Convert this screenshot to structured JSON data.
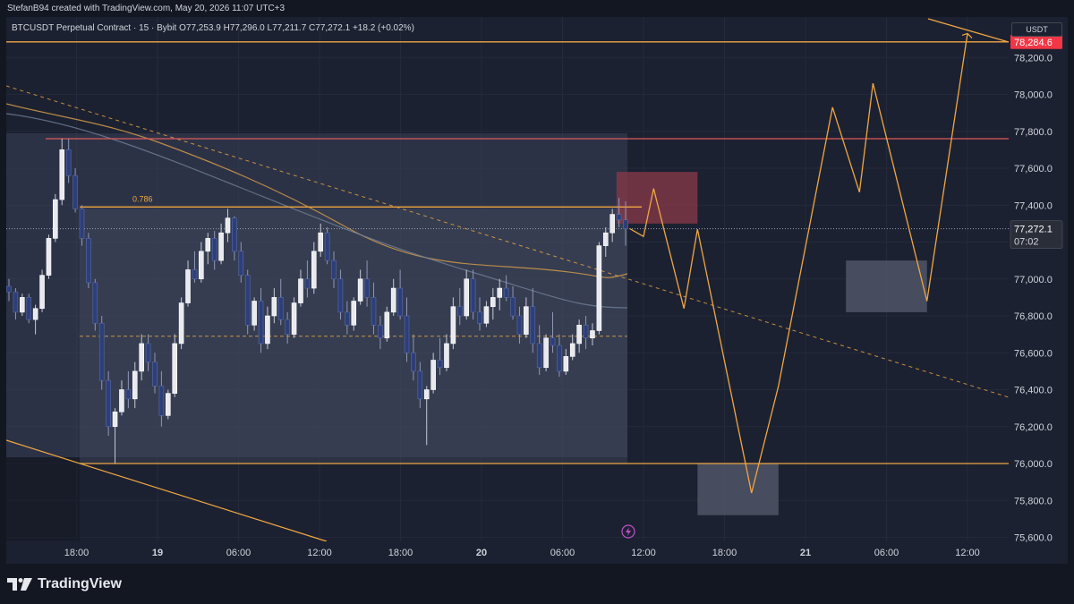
{
  "caption": "StefanB94 created with TradingView.com, May 20, 2026 11:07 UTC+3",
  "symbol": {
    "name": "BTCUSDT Perpetual Contract · 15 · Bybit",
    "ohlc": "O77,253.9  H77,296.0  L77,211.7  C77,272.1  +18.2 (+0.02%)"
  },
  "currency": "USDT",
  "watermark": "TradingView",
  "fib_label": "0.786",
  "colors": {
    "background": "#1c2131",
    "bull": "#e8eaef",
    "bear": "#2d3f7a",
    "accent": "#f0a742",
    "resistance": "#e05a5a",
    "price_tag": "#f23645"
  },
  "chart_data": {
    "type": "candlestick",
    "ylim": [
      75600,
      78400
    ],
    "price_ticks": [
      "75,600.0",
      "75,800.0",
      "76,000.0",
      "76,200.0",
      "76,400.0",
      "76,600.0",
      "76,800.0",
      "77,000.0",
      "77,200.0",
      "77,400.0",
      "77,600.0",
      "77,800.0",
      "78,000.0",
      "78,200.0"
    ],
    "time_ticks": [
      {
        "label": "18:00",
        "bold": false
      },
      {
        "label": "19",
        "bold": true
      },
      {
        "label": "06:00",
        "bold": false
      },
      {
        "label": "12:00",
        "bold": false
      },
      {
        "label": "18:00",
        "bold": false
      },
      {
        "label": "20",
        "bold": true
      },
      {
        "label": "06:00",
        "bold": false
      },
      {
        "label": "12:00",
        "bold": false
      },
      {
        "label": "18:00",
        "bold": false
      },
      {
        "label": "21",
        "bold": true
      },
      {
        "label": "06:00",
        "bold": false
      },
      {
        "label": "12:00",
        "bold": false
      }
    ],
    "last_price": {
      "value": 77272.1,
      "label": "77,272.1",
      "countdown": "07:02"
    },
    "target_price": {
      "value": 78284.6,
      "label": "78,284.6"
    },
    "levels": {
      "top": 78284.6,
      "resistance": 77760,
      "fib": 77390,
      "mid": 76690,
      "support": 76000
    },
    "candles": [
      [
        76960,
        77000,
        76880,
        76930
      ],
      [
        76930,
        76950,
        76780,
        76820
      ],
      [
        76820,
        76920,
        76800,
        76900
      ],
      [
        76900,
        76920,
        76760,
        76780
      ],
      [
        76780,
        76860,
        76700,
        76840
      ],
      [
        76840,
        77050,
        76820,
        77020
      ],
      [
        77020,
        77240,
        77000,
        77220
      ],
      [
        77220,
        77460,
        77200,
        77430
      ],
      [
        77430,
        77760,
        77400,
        77700
      ],
      [
        77700,
        77760,
        77520,
        77560
      ],
      [
        77560,
        77600,
        77360,
        77380
      ],
      [
        77380,
        77400,
        77180,
        77220
      ],
      [
        77220,
        77250,
        76950,
        76980
      ],
      [
        76980,
        77000,
        76720,
        76760
      ],
      [
        76760,
        76800,
        76400,
        76450
      ],
      [
        76450,
        76500,
        76150,
        76200
      ],
      [
        76200,
        76300,
        76000,
        76280
      ],
      [
        76280,
        76450,
        76260,
        76400
      ],
      [
        76400,
        76500,
        76300,
        76350
      ],
      [
        76350,
        76550,
        76300,
        76500
      ],
      [
        76500,
        76700,
        76450,
        76650
      ],
      [
        76650,
        76700,
        76500,
        76550
      ],
      [
        76550,
        76600,
        76380,
        76420
      ],
      [
        76420,
        76500,
        76200,
        76260
      ],
      [
        76260,
        76400,
        76240,
        76380
      ],
      [
        76380,
        76700,
        76360,
        76650
      ],
      [
        76650,
        76900,
        76620,
        76870
      ],
      [
        76870,
        77100,
        76850,
        77050
      ],
      [
        77050,
        77150,
        76980,
        77000
      ],
      [
        77000,
        77200,
        76980,
        77150
      ],
      [
        77150,
        77250,
        77080,
        77220
      ],
      [
        77220,
        77260,
        77050,
        77100
      ],
      [
        77100,
        77300,
        77080,
        77250
      ],
      [
        77250,
        77380,
        77200,
        77330
      ],
      [
        77330,
        77340,
        77100,
        77150
      ],
      [
        77150,
        77200,
        76980,
        77020
      ],
      [
        77020,
        77050,
        76700,
        76750
      ],
      [
        76750,
        76900,
        76720,
        76880
      ],
      [
        76880,
        76950,
        76600,
        76650
      ],
      [
        76650,
        76850,
        76620,
        76800
      ],
      [
        76800,
        76950,
        76760,
        76900
      ],
      [
        76900,
        77000,
        76750,
        76780
      ],
      [
        76780,
        76820,
        76650,
        76700
      ],
      [
        76700,
        76900,
        76680,
        76870
      ],
      [
        76870,
        77050,
        76850,
        77000
      ],
      [
        77000,
        77100,
        76900,
        76950
      ],
      [
        76950,
        77200,
        76920,
        77150
      ],
      [
        77150,
        77300,
        77120,
        77250
      ],
      [
        77250,
        77280,
        77080,
        77100
      ],
      [
        77100,
        77150,
        76950,
        77000
      ],
      [
        77000,
        77050,
        76780,
        76820
      ],
      [
        76820,
        76880,
        76700,
        76750
      ],
      [
        76750,
        76900,
        76720,
        76880
      ],
      [
        76880,
        77050,
        76860,
        77000
      ],
      [
        77000,
        77100,
        76850,
        76900
      ],
      [
        76900,
        76980,
        76700,
        76750
      ],
      [
        76750,
        76800,
        76620,
        76680
      ],
      [
        76680,
        76850,
        76660,
        76820
      ],
      [
        76820,
        77000,
        76800,
        76950
      ],
      [
        76950,
        77050,
        76780,
        76800
      ],
      [
        76800,
        76900,
        76550,
        76600
      ],
      [
        76600,
        76700,
        76450,
        76500
      ],
      [
        76500,
        76550,
        76300,
        76350
      ],
      [
        76350,
        76420,
        76100,
        76400
      ],
      [
        76400,
        76600,
        76380,
        76560
      ],
      [
        76560,
        76680,
        76480,
        76520
      ],
      [
        76520,
        76700,
        76500,
        76650
      ],
      [
        76650,
        76900,
        76620,
        76850
      ],
      [
        76850,
        76950,
        76750,
        76800
      ],
      [
        76800,
        77050,
        76780,
        77000
      ],
      [
        77000,
        77050,
        76780,
        76820
      ],
      [
        76820,
        76900,
        76720,
        76760
      ],
      [
        76760,
        76880,
        76740,
        76850
      ],
      [
        76850,
        76950,
        76780,
        76900
      ],
      [
        76900,
        77000,
        76830,
        76950
      ],
      [
        76950,
        77020,
        76880,
        76900
      ],
      [
        76900,
        76960,
        76780,
        76800
      ],
      [
        76800,
        76850,
        76650,
        76700
      ],
      [
        76700,
        76900,
        76680,
        76850
      ],
      [
        76850,
        76950,
        76600,
        76650
      ],
      [
        76650,
        76750,
        76480,
        76520
      ],
      [
        76520,
        76700,
        76500,
        76680
      ],
      [
        76680,
        76820,
        76600,
        76640
      ],
      [
        76640,
        76700,
        76470,
        76500
      ],
      [
        76500,
        76620,
        76480,
        76580
      ],
      [
        76580,
        76700,
        76560,
        76650
      ],
      [
        76650,
        76780,
        76600,
        76750
      ],
      [
        76750,
        76800,
        76620,
        76680
      ],
      [
        76680,
        76760,
        76640,
        76720
      ],
      [
        76720,
        77200,
        76700,
        77180
      ],
      [
        77180,
        77280,
        77120,
        77250
      ],
      [
        77250,
        77380,
        77200,
        77350
      ],
      [
        77350,
        77440,
        77280,
        77320
      ],
      [
        77320,
        77420,
        77180,
        77272.1
      ]
    ],
    "projection": [
      [
        "2026-05-20 11:00",
        77272
      ],
      [
        "2026-05-20 12:00",
        77230
      ],
      [
        "2026-05-20 12:45",
        77490
      ],
      [
        "2026-05-20 15:00",
        76840
      ],
      [
        "2026-05-20 16:00",
        77270
      ],
      [
        "2026-05-20 20:00",
        75840
      ],
      [
        "2026-05-20 22:00",
        76420
      ],
      [
        "2026-05-21 02:00",
        77930
      ],
      [
        "2026-05-21 04:00",
        77470
      ],
      [
        "2026-05-21 05:00",
        78060
      ],
      [
        "2026-05-21 09:00",
        76880
      ],
      [
        "2026-05-21 12:00",
        78330
      ]
    ],
    "boxes": [
      {
        "name": "supply-zone",
        "from": "2026-05-20 10:00",
        "to": "2026-05-20 16:00",
        "high": 77580,
        "low": 77300
      },
      {
        "name": "demand-zone-low",
        "from": "2026-05-20 16:00",
        "to": "2026-05-20 22:00",
        "high": 76000,
        "low": 75720
      },
      {
        "name": "demand-zone-high",
        "from": "2026-05-21 03:00",
        "to": "2026-05-21 09:00",
        "high": 77100,
        "low": 76820
      }
    ]
  }
}
